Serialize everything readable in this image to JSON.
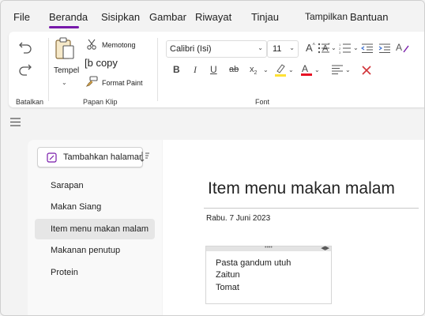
{
  "menu": {
    "items": [
      {
        "label": "File"
      },
      {
        "label": "Beranda"
      },
      {
        "label": "Sisipkan"
      },
      {
        "label": "Gambar"
      },
      {
        "label": "Riwayat"
      },
      {
        "label": "Tinjau"
      },
      {
        "label": "Tampilkan"
      },
      {
        "label": "Bantuan"
      }
    ],
    "active": "Beranda"
  },
  "ribbon": {
    "undo": {
      "group_label": "Batalkan"
    },
    "clipboard": {
      "group_label": "Papan Klip",
      "paste_label": "Tempel",
      "cut_label": "Memotong",
      "copy_label": "[b copy",
      "format_paint_label": "Format Paint"
    },
    "font": {
      "group_label": "Font",
      "font_name": "Calibri (Isi)",
      "font_size": "11"
    }
  },
  "pages": {
    "add_page_label": "Tambahkan halaman",
    "items": [
      {
        "label": "Sarapan"
      },
      {
        "label": "Makan Siang"
      },
      {
        "label": "Item menu makan malam"
      },
      {
        "label": "Makanan penutup"
      },
      {
        "label": "Protein"
      }
    ],
    "selected": "Item menu makan malam"
  },
  "page": {
    "title": "Item menu makan malam",
    "date": "Rabu. 7 Juni 2023",
    "note_lines": [
      "Pasta gandum utuh",
      "Zaitun",
      "Tomat"
    ]
  },
  "colors": {
    "accent": "#7719aa",
    "font_color_red": "#e81123",
    "highlight_yellow": "#ffe135",
    "clear_red": "#d13438"
  }
}
